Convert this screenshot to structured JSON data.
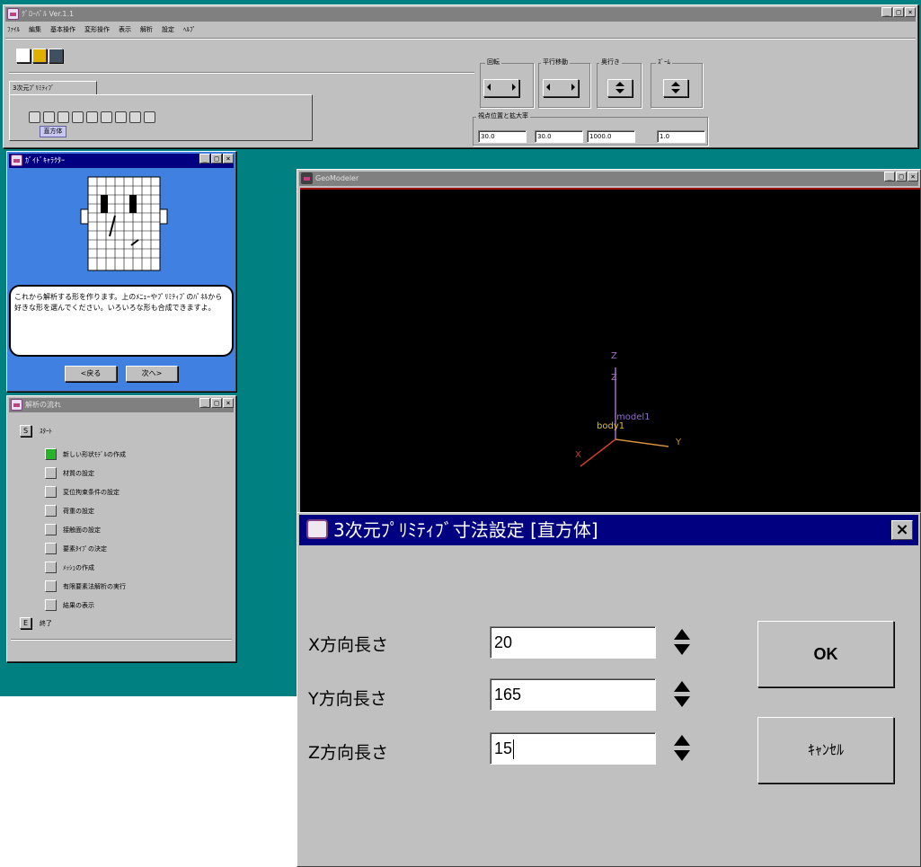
{
  "main_window": {
    "title": "ｸﾞﾛｰﾊﾞﾙ Ver.1.1",
    "menu": [
      "ﾌｧｲﾙ",
      "編集",
      "基本操作",
      "変形操作",
      "表示",
      "解析",
      "設定",
      "ﾍﾙﾌﾟ"
    ],
    "tab_label": "3次元ﾌﾟﾘﾐﾃｨﾌﾞ",
    "tooltip": "直方体",
    "groups": {
      "rotate": "回転",
      "translate": "平行移動",
      "depth": "奥行き",
      "zoom": "ｽﾞｰﾑ",
      "view": "視点位置と拡大率"
    },
    "view_values": [
      "30.0",
      "30.0",
      "1000.0",
      "1.0"
    ]
  },
  "guide_window": {
    "title": "ｶﾞｲﾄﾞｷｬﾗｸﾀｰ",
    "message": "これから解析する形を作ります。上のﾒﾆｭｰやﾌﾟﾘﾐﾃｨﾌﾞのﾊﾟﾈﾙから好きな形を選んでください。いろいろな形も合成できますよ。",
    "back_label": "<戻る",
    "next_label": "次へ>"
  },
  "steps_window": {
    "title": "解析の流れ",
    "start_marker": "S",
    "start_label": "ｽﾀｰﾄ",
    "steps": [
      "新しい形状ﾓﾃﾞﾙの作成",
      "材質の設定",
      "変位拘束条件の設定",
      "荷重の設定",
      "接触面の設定",
      "要素ﾀｲﾌﾟの決定",
      "ﾒｯｼｭの作成",
      "有限要素法解析の実行",
      "結果の表示"
    ],
    "end_marker": "E",
    "end_label": "終了"
  },
  "viewer_window": {
    "title": "GeoModeler",
    "axes": {
      "x": "X",
      "y": "Y",
      "z": "Z",
      "z2": "Z"
    },
    "labels": {
      "model": "model1",
      "body": "body1"
    }
  },
  "dialog": {
    "title": "3次元ﾌﾟﾘﾐﾃｨﾌﾞ寸法設定 [直方体]",
    "close_glyph": "×",
    "fields": [
      {
        "label": "X方向長さ",
        "value": "20"
      },
      {
        "label": "Y方向長さ",
        "value": "165"
      },
      {
        "label": "Z方向長さ",
        "value": "15"
      }
    ],
    "ok_label": "OK",
    "cancel_label": "ｷｬﾝｾﾙ"
  },
  "colors": {
    "desktop": "#008080",
    "titlebar_active": "#000080",
    "titlebar_inactive": "#808080",
    "step_done": "#28b428",
    "axis_x": "#d04030",
    "axis_y": "#d09040",
    "axis_z": "#a070c0",
    "label_model": "#9070d0",
    "label_body": "#e0c020"
  }
}
